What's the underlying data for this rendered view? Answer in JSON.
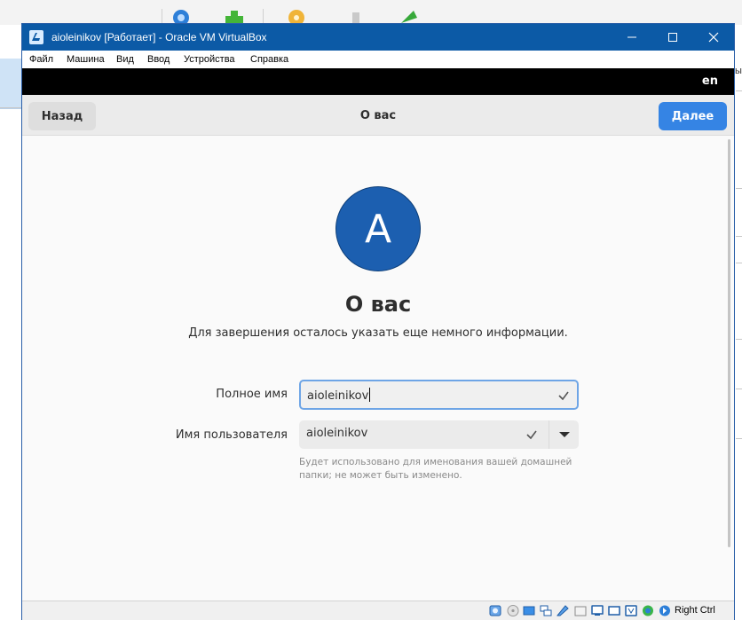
{
  "window": {
    "title": "aioleinikov [Работает] - Oracle VM VirtualBox",
    "controls": [
      "minimize",
      "maximize",
      "close"
    ]
  },
  "menu": {
    "items": [
      "Файл",
      "Машина",
      "Вид",
      "Ввод",
      "Устройства",
      "Справка"
    ]
  },
  "guest": {
    "topbar": {
      "language": "en"
    },
    "header": {
      "back_label": "Назад",
      "title": "О вас",
      "next_label": "Далее"
    },
    "avatar": {
      "initial": "A"
    },
    "heading": "О вас",
    "subtitle": "Для завершения осталось указать еще немного информации.",
    "full_name": {
      "label": "Полное имя",
      "value": "aioleinikov"
    },
    "username": {
      "label": "Имя пользователя",
      "value": "aioleinikov"
    },
    "hint": "Будет использовано для именования вашей домашней папки; не может быть изменено."
  },
  "statusbar": {
    "host_key": "Right Ctrl",
    "icons": [
      "hard-disk-icon",
      "optical-drive-icon",
      "audio-icon",
      "network-icon",
      "usb-icon",
      "shared-folders-icon",
      "display-icon",
      "video-capture-icon",
      "recording-icon",
      "virtualization-icon",
      "mouse-integration-icon",
      "keyboard-icon"
    ]
  },
  "background": {
    "right_edge_text": "ы"
  },
  "colors": {
    "titlebar": "#0c5aa6",
    "accent": "#3584e4",
    "avatar": "#1c5fb0"
  }
}
